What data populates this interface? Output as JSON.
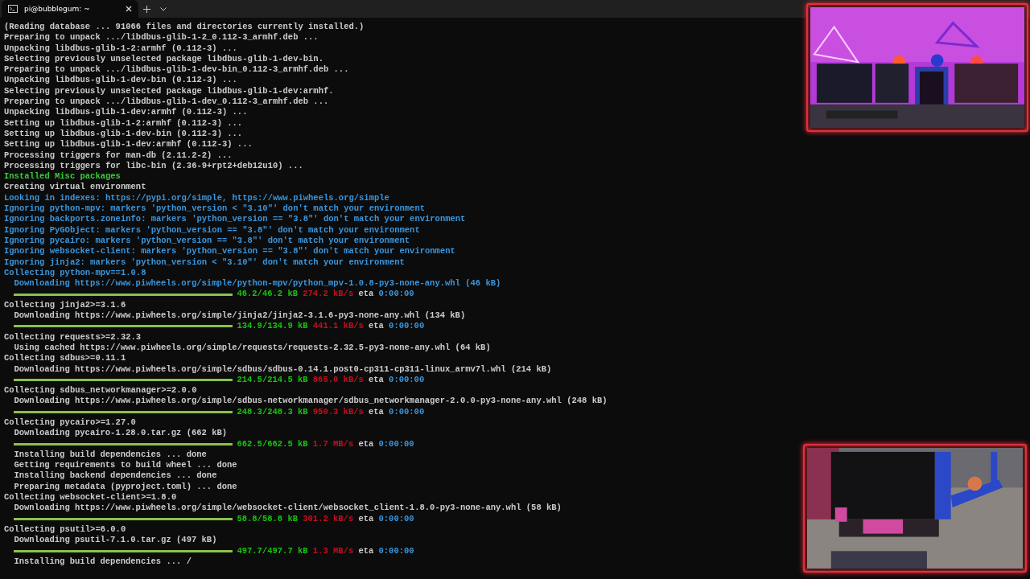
{
  "tab": {
    "title": "pi@bubblegum: ~",
    "selected": true
  },
  "terminal": {
    "lines": [
      {
        "kind": "text",
        "color": "#cccccc",
        "text": "(Reading database ... 91066 files and directories currently installed.)"
      },
      {
        "kind": "text",
        "color": "#cccccc",
        "text": "Preparing to unpack .../libdbus-glib-1-2_0.112-3_armhf.deb ..."
      },
      {
        "kind": "text",
        "color": "#cccccc",
        "text": "Unpacking libdbus-glib-1-2:armhf (0.112-3) ..."
      },
      {
        "kind": "text",
        "color": "#cccccc",
        "text": "Selecting previously unselected package libdbus-glib-1-dev-bin."
      },
      {
        "kind": "text",
        "color": "#cccccc",
        "text": "Preparing to unpack .../libdbus-glib-1-dev-bin_0.112-3_armhf.deb ..."
      },
      {
        "kind": "text",
        "color": "#cccccc",
        "text": "Unpacking libdbus-glib-1-dev-bin (0.112-3) ..."
      },
      {
        "kind": "text",
        "color": "#cccccc",
        "text": "Selecting previously unselected package libdbus-glib-1-dev:armhf."
      },
      {
        "kind": "text",
        "color": "#cccccc",
        "text": "Preparing to unpack .../libdbus-glib-1-dev_0.112-3_armhf.deb ..."
      },
      {
        "kind": "text",
        "color": "#cccccc",
        "text": "Unpacking libdbus-glib-1-dev:armhf (0.112-3) ..."
      },
      {
        "kind": "text",
        "color": "#cccccc",
        "text": "Setting up libdbus-glib-1-2:armhf (0.112-3) ..."
      },
      {
        "kind": "text",
        "color": "#cccccc",
        "text": "Setting up libdbus-glib-1-dev-bin (0.112-3) ..."
      },
      {
        "kind": "text",
        "color": "#cccccc",
        "text": "Setting up libdbus-glib-1-dev:armhf (0.112-3) ..."
      },
      {
        "kind": "text",
        "color": "#cccccc",
        "text": "Processing triggers for man-db (2.11.2-2) ..."
      },
      {
        "kind": "text",
        "color": "#cccccc",
        "text": "Processing triggers for libc-bin (2.36-9+rpt2+deb12u10) ..."
      },
      {
        "kind": "text",
        "color": "#3cc83c",
        "text": "Installed Misc packages"
      },
      {
        "kind": "text",
        "color": "#cccccc",
        "text": "Creating virtual environment"
      },
      {
        "kind": "text",
        "color": "#3a96dd",
        "text": "Looking in indexes: https://pypi.org/simple, https://www.piwheels.org/simple"
      },
      {
        "kind": "text",
        "color": "#3a96dd",
        "text": "Ignoring python-mpv: markers 'python_version < \"3.10\"' don't match your environment"
      },
      {
        "kind": "text",
        "color": "#3a96dd",
        "text": "Ignoring backports.zoneinfo: markers 'python_version == \"3.8\"' don't match your environment"
      },
      {
        "kind": "text",
        "color": "#3a96dd",
        "text": "Ignoring PyGObject: markers 'python_version == \"3.8\"' don't match your environment"
      },
      {
        "kind": "text",
        "color": "#3a96dd",
        "text": "Ignoring pycairo: markers 'python_version == \"3.8\"' don't match your environment"
      },
      {
        "kind": "text",
        "color": "#3a96dd",
        "text": "Ignoring websocket-client: markers 'python_version == \"3.8\"' don't match your environment"
      },
      {
        "kind": "text",
        "color": "#3a96dd",
        "text": "Ignoring jinja2: markers 'python_version < \"3.10\"' don't match your environment"
      },
      {
        "kind": "text",
        "color": "#3a96dd",
        "text": "Collecting python-mpv==1.0.8"
      },
      {
        "kind": "text",
        "color": "#3a96dd",
        "indented": true,
        "text": "Downloading https://www.piwheels.org/simple/python-mpv/python_mpv-1.0.8-py3-none-any.whl (46 kB)"
      },
      {
        "kind": "progress",
        "level": 1,
        "amount": "46.2/46.2 kB",
        "speed": "274.2 kB/s",
        "eta_label": "eta",
        "eta": "0:00:00"
      },
      {
        "kind": "text",
        "color": "#cccccc",
        "text": "Collecting jinja2>=3.1.6"
      },
      {
        "kind": "text",
        "color": "#cccccc",
        "indented": true,
        "text": "Downloading https://www.piwheels.org/simple/jinja2/jinja2-3.1.6-py3-none-any.whl (134 kB)"
      },
      {
        "kind": "progress",
        "level": 1,
        "amount": "134.9/134.9 kB",
        "speed": "441.1 kB/s",
        "eta_label": "eta",
        "eta": "0:00:00"
      },
      {
        "kind": "text",
        "color": "#cccccc",
        "text": "Collecting requests>=2.32.3"
      },
      {
        "kind": "text",
        "color": "#cccccc",
        "indented": true,
        "text": "Using cached https://www.piwheels.org/simple/requests/requests-2.32.5-py3-none-any.whl (64 kB)"
      },
      {
        "kind": "text",
        "color": "#cccccc",
        "text": "Collecting sdbus>=0.11.1"
      },
      {
        "kind": "text",
        "color": "#cccccc",
        "indented": true,
        "text": "Downloading https://www.piwheels.org/simple/sdbus/sdbus-0.14.1.post0-cp311-cp311-linux_armv7l.whl (214 kB)"
      },
      {
        "kind": "progress",
        "level": 1,
        "amount": "214.5/214.5 kB",
        "speed": "865.0 kB/s",
        "eta_label": "eta",
        "eta": "0:00:00"
      },
      {
        "kind": "text",
        "color": "#cccccc",
        "text": "Collecting sdbus_networkmanager>=2.0.0"
      },
      {
        "kind": "text",
        "color": "#cccccc",
        "indented": true,
        "text": "Downloading https://www.piwheels.org/simple/sdbus-networkmanager/sdbus_networkmanager-2.0.0-py3-none-any.whl (248 kB)"
      },
      {
        "kind": "progress",
        "level": 1,
        "amount": "248.3/248.3 kB",
        "speed": "950.3 kB/s",
        "eta_label": "eta",
        "eta": "0:00:00"
      },
      {
        "kind": "text",
        "color": "#cccccc",
        "text": "Collecting pycairo>=1.27.0"
      },
      {
        "kind": "text",
        "color": "#cccccc",
        "indented": true,
        "text": "Downloading pycairo-1.28.0.tar.gz (662 kB)"
      },
      {
        "kind": "progress",
        "level": 1,
        "amount": "662.5/662.5 kB",
        "speed": "1.7 MB/s",
        "eta_label": "eta",
        "eta": "0:00:00"
      },
      {
        "kind": "text",
        "color": "#cccccc",
        "indented": true,
        "text": "Installing build dependencies ... done"
      },
      {
        "kind": "text",
        "color": "#cccccc",
        "indented": true,
        "text": "Getting requirements to build wheel ... done"
      },
      {
        "kind": "text",
        "color": "#cccccc",
        "indented": true,
        "text": "Installing backend dependencies ... done"
      },
      {
        "kind": "text",
        "color": "#cccccc",
        "indented": true,
        "text": "Preparing metadata (pyproject.toml) ... done"
      },
      {
        "kind": "text",
        "color": "#cccccc",
        "text": "Collecting websocket-client>=1.8.0"
      },
      {
        "kind": "text",
        "color": "#cccccc",
        "indented": true,
        "text": "Downloading https://www.piwheels.org/simple/websocket-client/websocket_client-1.8.0-py3-none-any.whl (58 kB)"
      },
      {
        "kind": "progress",
        "level": 1,
        "amount": "58.8/58.8 kB",
        "speed": "301.2 kB/s",
        "eta_label": "eta",
        "eta": "0:00:00"
      },
      {
        "kind": "text",
        "color": "#cccccc",
        "text": "Collecting psutil>=6.0.0"
      },
      {
        "kind": "text",
        "color": "#cccccc",
        "indented": true,
        "text": "Downloading psutil-7.1.0.tar.gz (497 kB)"
      },
      {
        "kind": "progress",
        "level": 1,
        "amount": "497.7/497.7 kB",
        "speed": "1.3 MB/s",
        "eta_label": "eta",
        "eta": "0:00:00"
      },
      {
        "kind": "text",
        "color": "#cccccc",
        "indented": true,
        "text": "Installing build dependencies ... /"
      }
    ]
  }
}
